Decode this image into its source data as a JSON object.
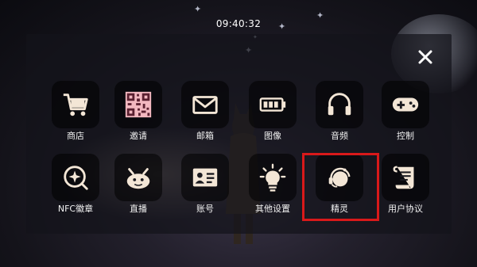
{
  "status_bar": {
    "time": "09:40:32"
  },
  "menu": {
    "items": [
      {
        "id": "shop",
        "label": "商店",
        "icon": "shopping-cart-icon"
      },
      {
        "id": "invite",
        "label": "邀请",
        "icon": "qr-code-icon"
      },
      {
        "id": "mailbox",
        "label": "邮箱",
        "icon": "envelope-icon"
      },
      {
        "id": "graphics",
        "label": "图像",
        "icon": "battery-icon"
      },
      {
        "id": "audio",
        "label": "音频",
        "icon": "headphones-icon"
      },
      {
        "id": "controls",
        "label": "控制",
        "icon": "gamepad-icon"
      },
      {
        "id": "nfc-badge",
        "label": "NFC徽章",
        "icon": "nfc-star-badge-icon"
      },
      {
        "id": "live",
        "label": "直播",
        "icon": "live-crab-icon"
      },
      {
        "id": "account",
        "label": "账号",
        "icon": "id-card-icon"
      },
      {
        "id": "other-settings",
        "label": "其他设置",
        "icon": "lightbulb-icon"
      },
      {
        "id": "sprite",
        "label": "精灵",
        "icon": "headset-sprite-icon"
      },
      {
        "id": "user-agreement",
        "label": "用户协议",
        "icon": "scroll-icon"
      }
    ],
    "highlighted": "sprite"
  },
  "colors": {
    "icon": "#f3e6d6",
    "highlight": "#d9191a",
    "panel": "#14141a"
  },
  "close_icon": "close-icon"
}
